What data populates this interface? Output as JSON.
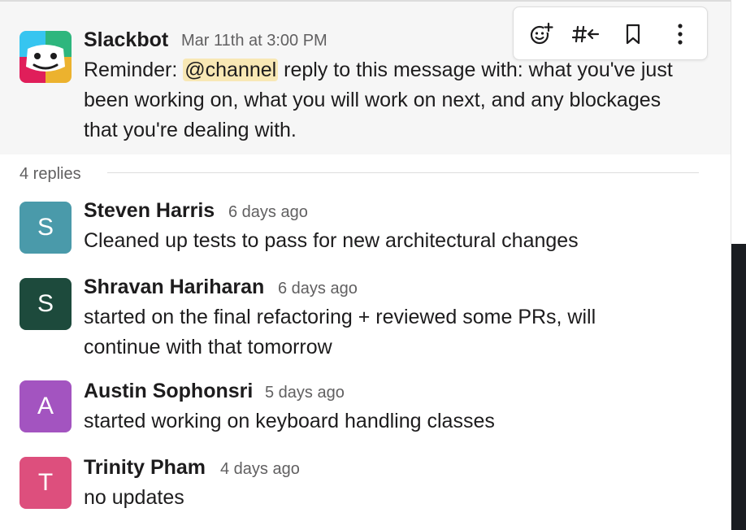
{
  "parent_message": {
    "author": "Slackbot",
    "timestamp": "Mar 11th at 3:00 PM",
    "text_before": "Reminder: ",
    "mention": "@channel",
    "text_after": " reply to this message with: what you've just been working on, what you will work on next, and any blockages that you're dealing with.",
    "avatar_icon": "slackbot-icon"
  },
  "toolbar": {
    "actions": [
      "add-reaction-icon",
      "reply-in-channel-icon",
      "bookmark-icon",
      "more-actions-icon"
    ]
  },
  "thread": {
    "reply_count_label": "4 replies"
  },
  "replies": [
    {
      "author": "Steven Harris",
      "initial": "S",
      "timestamp": "6 days ago",
      "text": "Cleaned up tests to pass for new architectural changes",
      "avatar_color": "#4a9aaa"
    },
    {
      "author": "Shravan Hariharan",
      "initial": "S",
      "timestamp": "6 days ago",
      "text": "started on the final refactoring + reviewed some PRs, will continue with that tomorrow",
      "avatar_color": "#1d4a3c"
    },
    {
      "author": "Austin Sophonsri",
      "initial": "A",
      "timestamp": "5 days ago",
      "text": "started working on keyboard handling classes",
      "avatar_color": "#a354c0"
    },
    {
      "author": "Trinity Pham",
      "initial": "T",
      "timestamp": "4 days ago",
      "text": "no updates",
      "avatar_color": "#dd4f7d"
    }
  ]
}
